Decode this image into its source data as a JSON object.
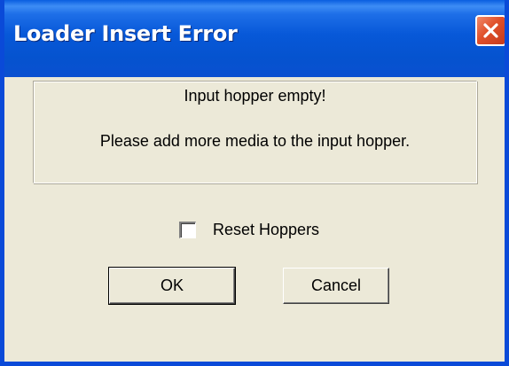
{
  "window": {
    "title": "Loader Insert Error"
  },
  "message": {
    "line1": "Input hopper empty!",
    "line2": "Please add more media to the input hopper."
  },
  "checkbox": {
    "label": "Reset Hoppers",
    "checked": false
  },
  "buttons": {
    "ok_label": "OK",
    "cancel_label": "Cancel"
  },
  "icons": {
    "close": "close-icon"
  },
  "colors": {
    "titlebar": "#0758d8",
    "close_button": "#e0502a",
    "dialog_background": "#ece9d8"
  }
}
